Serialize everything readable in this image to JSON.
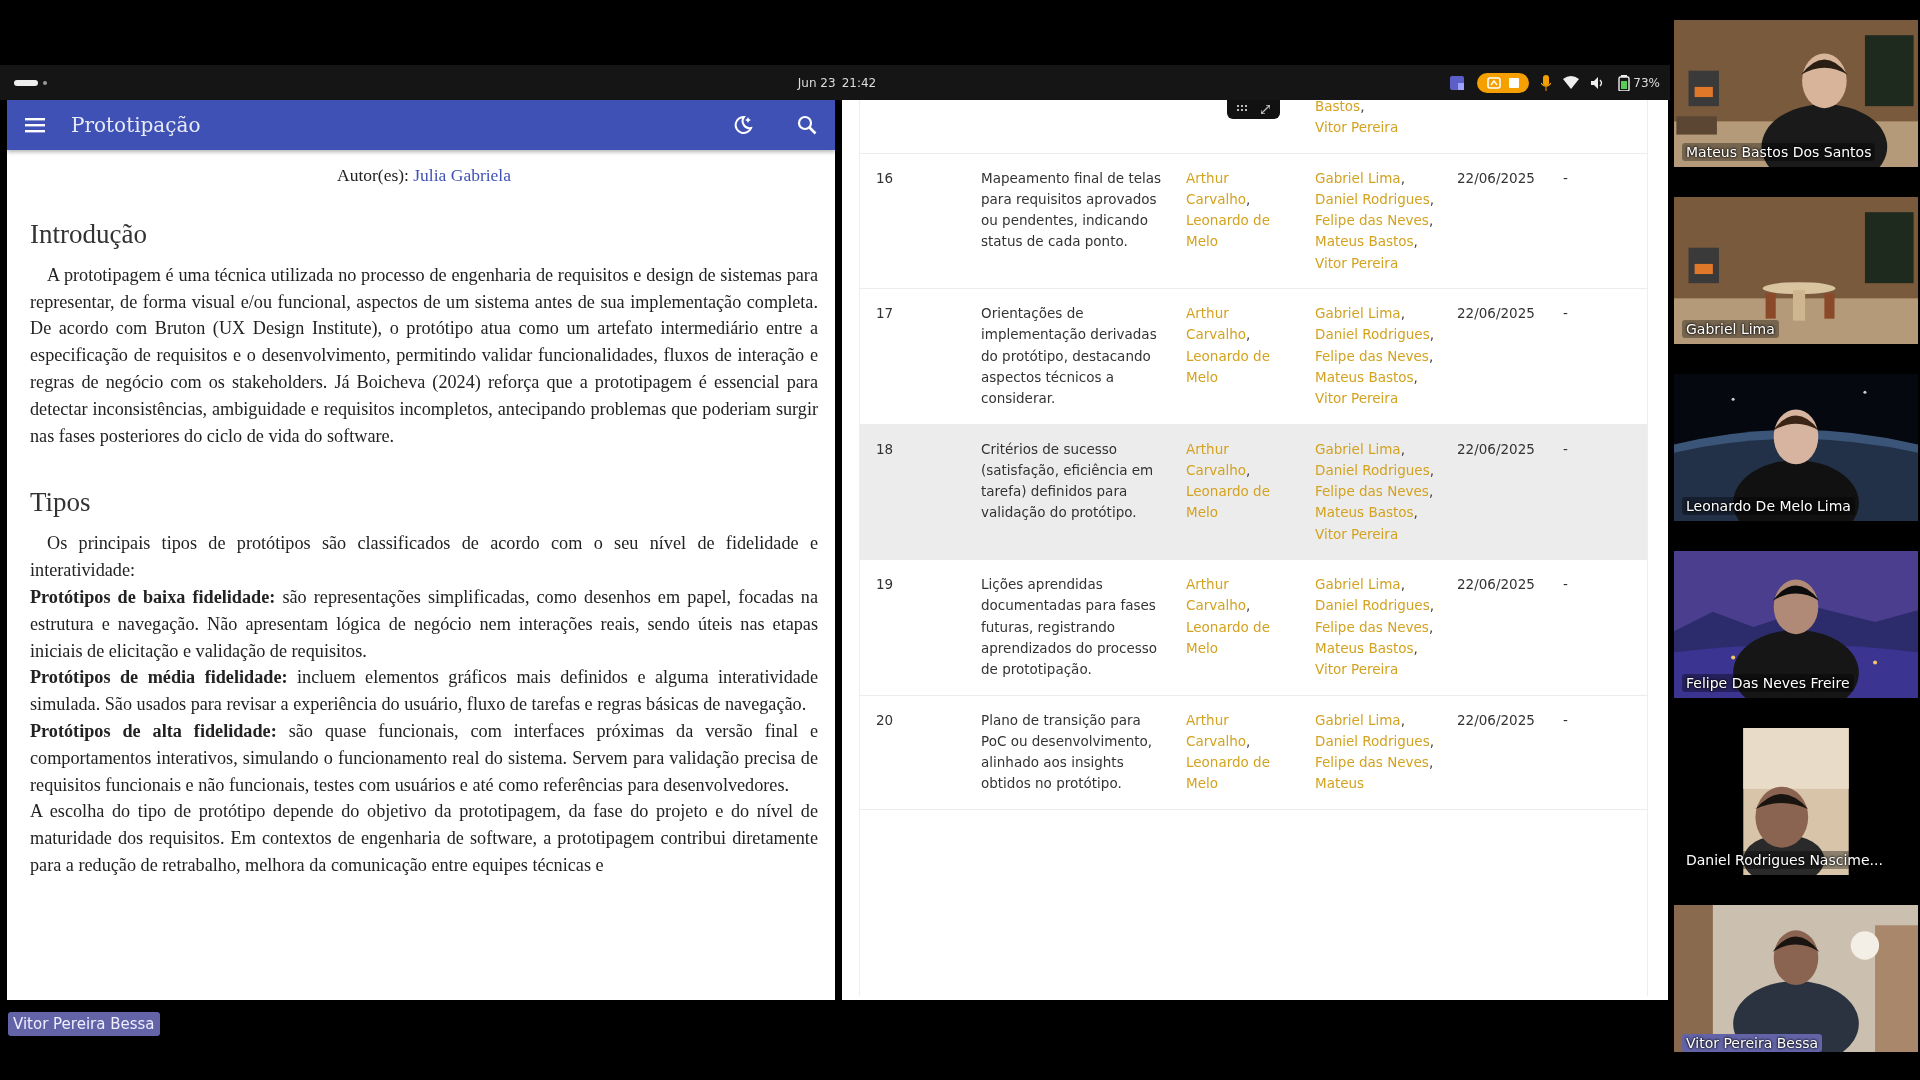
{
  "status_bar": {
    "date": "Jun 23",
    "time": "21:42",
    "battery": "73%"
  },
  "document": {
    "title": "Prototipação",
    "author_label": "Autor(es):",
    "author": "Julia Gabriela",
    "sections": [
      {
        "heading": "Introdução",
        "paragraphs": [
          {
            "indented": true,
            "text": "A prototipagem é uma técnica utilizada no processo de engenharia de requisitos e design de sistemas para representar, de forma visual e/ou funcional, aspectos de um sistema antes de sua implementação completa. De acordo com Bruton (UX Design Institute), o protótipo atua como um artefato intermediário entre a especificação de requisitos e o desenvolvimento, permitindo validar funcionalidades, fluxos de interação e regras de negócio com os stakeholders. Já Boicheva (2024) reforça que a prototipagem é essencial para detectar inconsistências, ambiguidade e requisitos incompletos, antecipando problemas que poderiam surgir nas fases posteriores do ciclo de vida do software."
          }
        ]
      },
      {
        "heading": "Tipos",
        "paragraphs": [
          {
            "indented": true,
            "text": "Os principais tipos de protótipos são classificados de acordo com o seu nível de fidelidade e interatividade:"
          },
          {
            "indented": false,
            "text": "**Protótipos de baixa fidelidade:** são representações simplificadas, como desenhos em papel, focadas na estrutura e navegação. Não apresentam lógica de negócio nem interações reais, sendo úteis nas etapas iniciais de elicitação e validação de requisitos."
          },
          {
            "indented": false,
            "text": "**Protótipos de média fidelidade:** incluem elementos gráficos mais definidos e alguma interatividade simulada. São usados para revisar a experiência do usuário, fluxo de tarefas e regras básicas de navegação."
          },
          {
            "indented": false,
            "text": "**Protótipos de alta fidelidade:** são quase funcionais, com interfaces próximas da versão final e comportamentos interativos, simulando o funcionamento real do sistema. Servem para validação precisa de requisitos funcionais e não funcionais, testes com usuários e até como referências para desenvolvedores."
          },
          {
            "indented": false,
            "text": "A escolha do tipo de protótipo depende do objetivo da prototipagem, da fase do projeto e do nível de maturidade dos requisitos. Em contextos de engenharia de software, a prototipagem contribui diretamente para a redução de retrabalho, melhora da comunicação entre equipes técnicas e"
          }
        ]
      }
    ]
  },
  "table": {
    "name_separator": ",",
    "rows": [
      {
        "participants": [
          "Bastos",
          "Vitor Pereira"
        ],
        "hovered": false
      },
      {
        "number": "16",
        "description": "Mapeamento final de telas para requisitos aprovados ou pendentes, indicando status de cada ponto.",
        "responsible": [
          "Arthur Carvalho",
          "Leonardo de Melo"
        ],
        "participants": [
          "Gabriel Lima",
          "Daniel Rodrigues",
          "Felipe das Neves",
          "Mateus Bastos",
          "Vitor Pereira"
        ],
        "date": "22/06/2025",
        "status": "-",
        "hovered": false
      },
      {
        "number": "17",
        "description": "Orientações de implementação derivadas do protótipo, destacando aspectos técnicos a considerar.",
        "responsible": [
          "Arthur Carvalho",
          "Leonardo de Melo"
        ],
        "participants": [
          "Gabriel Lima",
          "Daniel Rodrigues",
          "Felipe das Neves",
          "Mateus Bastos",
          "Vitor Pereira"
        ],
        "date": "22/06/2025",
        "status": "-",
        "hovered": false
      },
      {
        "number": "18",
        "description": "Critérios de sucesso (satisfação, eficiência em tarefa) definidos para validação do protótipo.",
        "responsible": [
          "Arthur Carvalho",
          "Leonardo de Melo"
        ],
        "participants": [
          "Gabriel Lima",
          "Daniel Rodrigues",
          "Felipe das Neves",
          "Mateus Bastos",
          "Vitor Pereira"
        ],
        "date": "22/06/2025",
        "status": "-",
        "hovered": true
      },
      {
        "number": "19",
        "description": "Lições aprendidas documentadas para fases futuras, registrando aprendizados do processo de prototipação.",
        "responsible": [
          "Arthur Carvalho",
          "Leonardo de Melo"
        ],
        "participants": [
          "Gabriel Lima",
          "Daniel Rodrigues",
          "Felipe das Neves",
          "Mateus Bastos",
          "Vitor Pereira"
        ],
        "date": "22/06/2025",
        "status": "-",
        "hovered": false
      },
      {
        "number": "20",
        "description": "Plano de transição para PoC ou desenvolvimento, alinhado aos insights obtidos no protótipo.",
        "responsible": [
          "Arthur Carvalho",
          "Leonardo de Melo"
        ],
        "participants": [
          "Gabriel Lima",
          "Daniel Rodrigues",
          "Felipe das Neves",
          "Mateus"
        ],
        "date": "22/06/2025",
        "status": "-",
        "hovered": false
      }
    ]
  },
  "call_participants": [
    {
      "name": "Mateus Bastos Dos Santos",
      "highlighted": false
    },
    {
      "name": "Gabriel Lima",
      "highlighted": false
    },
    {
      "name": "Leonardo De Melo Lima",
      "highlighted": false
    },
    {
      "name": "Felipe Das Neves Freire",
      "highlighted": false
    },
    {
      "name": "Daniel Rodrigues Nascime...",
      "highlighted": false
    },
    {
      "name": "Vitor Pereira Bessa",
      "highlighted": true
    }
  ],
  "presenter_label": "Vitor Pereira Bessa"
}
